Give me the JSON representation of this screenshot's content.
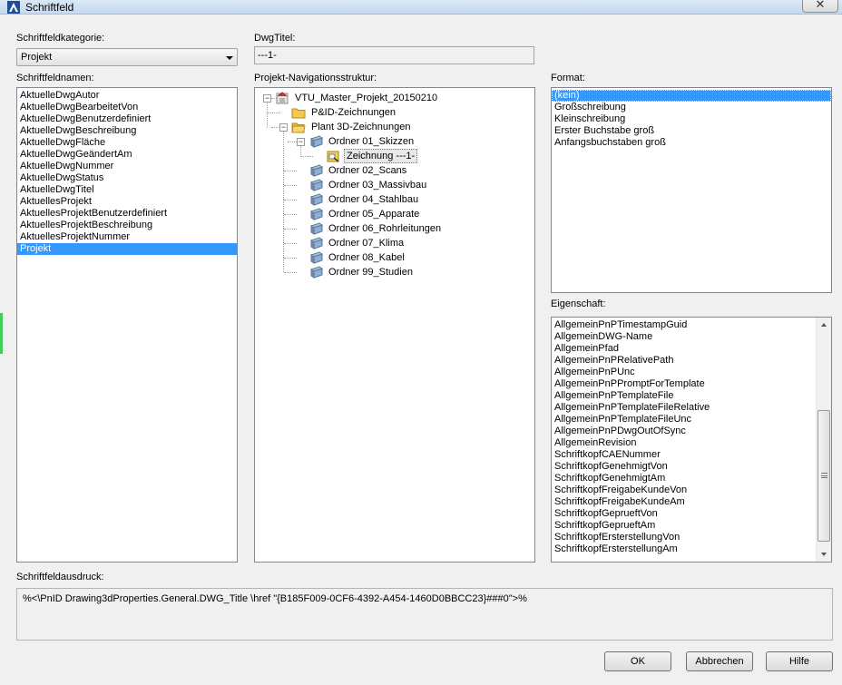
{
  "window": {
    "title": "Schriftfeld",
    "close_glyph": "✕"
  },
  "category": {
    "label": "Schriftfeldkategorie:",
    "selected": "Projekt"
  },
  "dwg_title": {
    "label": "DwgTitel:",
    "value": "---1-"
  },
  "field_names": {
    "label": "Schriftfeldnamen:",
    "items": [
      "AktuelleDwgAutor",
      "AktuelleDwgBearbeitetVon",
      "AktuelleDwgBenutzerdefiniert",
      "AktuelleDwgBeschreibung",
      "AktuelleDwgFläche",
      "AktuelleDwgGeändertAm",
      "AktuelleDwgNummer",
      "AktuelleDwgStatus",
      "AktuelleDwgTitel",
      "AktuellesProjekt",
      "AktuellesProjektBenutzerdefiniert",
      "AktuellesProjektBeschreibung",
      "AktuellesProjektNummer",
      "Projekt"
    ],
    "selected_index": 13
  },
  "nav_tree": {
    "label": "Projekt-Navigationsstruktur:",
    "root": "VTU_Master_Projekt_20150210",
    "pid": "P&ID-Zeichnungen",
    "plant3d": "Plant 3D-Zeichnungen",
    "folders": [
      "Ordner 01_Skizzen",
      "Ordner 02_Scans",
      "Ordner 03_Massivbau",
      "Ordner 04_Stahlbau",
      "Ordner 05_Apparate",
      "Ordner 06_Rohrleitungen",
      "Ordner 07_Klima",
      "Ordner 08_Kabel",
      "Ordner 99_Studien"
    ],
    "drawing": "Zeichnung ---1-"
  },
  "format": {
    "label": "Format:",
    "items": [
      "(kein)",
      "Großschreibung",
      "Kleinschreibung",
      "Erster Buchstabe groß",
      "Anfangsbuchstaben groß"
    ],
    "selected_index": 0
  },
  "property": {
    "label": "Eigenschaft:",
    "items": [
      "AllgemeinPnPTimestampGuid",
      "AllgemeinDWG-Name",
      "AllgemeinPfad",
      "AllgemeinPnPRelativePath",
      "AllgemeinPnPUnc",
      "AllgemeinPnPPromptForTemplate",
      "AllgemeinPnPTemplateFile",
      "AllgemeinPnPTemplateFileRelative",
      "AllgemeinPnPTemplateFileUnc",
      "AllgemeinPnPDwgOutOfSync",
      "AllgemeinRevision",
      "SchriftkopfCAENummer",
      "SchriftkopfGenehmigtVon",
      "SchriftkopfGenehmigtAm",
      "SchriftkopfFreigabeKundeVon",
      "SchriftkopfFreigabeKundeAm",
      "SchriftkopfGeprueftVon",
      "SchriftkopfGeprueftAm",
      "SchriftkopfErsterstellungVon",
      "SchriftkopfErsterstellungAm"
    ]
  },
  "expression": {
    "label": "Schriftfeldausdruck:",
    "value": "%<\\PnID Drawing3dProperties.General.DWG_Title \\href \"{B185F009-0CF6-4392-A454-1460D0BBCC23}###0\">%"
  },
  "buttons": {
    "ok": "OK",
    "cancel": "Abbrechen",
    "help": "Hilfe"
  },
  "colors": {
    "selection": "#3399ff",
    "folder": "#f2c94c",
    "dialog_bg": "#f0f0f0"
  }
}
